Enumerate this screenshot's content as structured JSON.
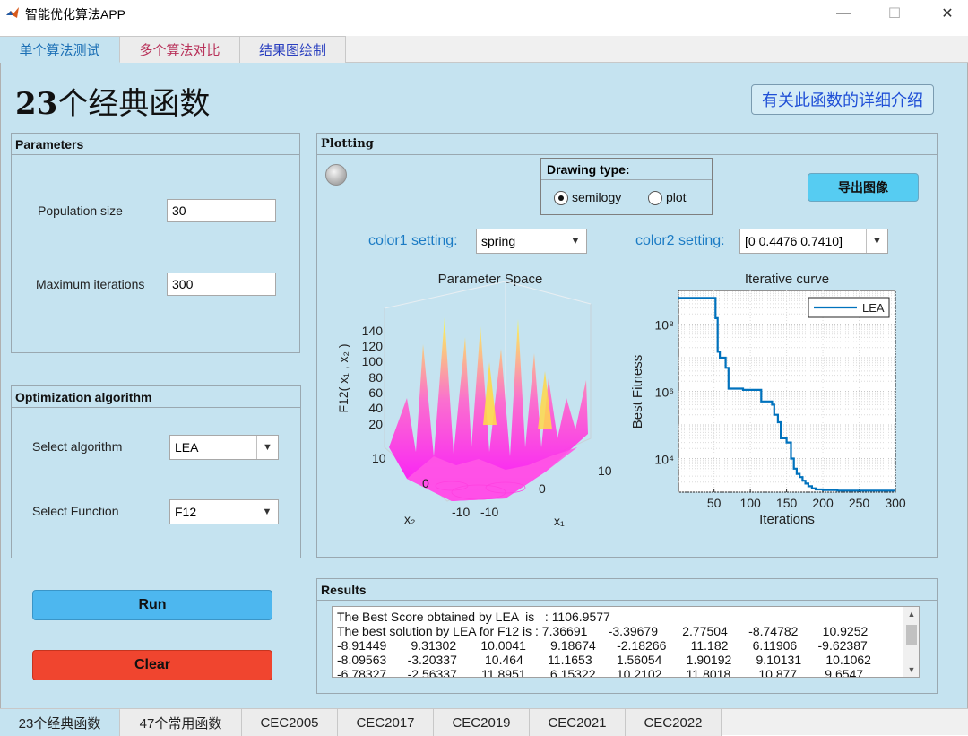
{
  "window": {
    "title": "智能优化算法APP",
    "minimize": "—",
    "maximize": "☐",
    "close": "✕"
  },
  "top_tabs": [
    "单个算法测试",
    "多个算法对比",
    "结果图绘制"
  ],
  "header": {
    "title_num": "23",
    "title_text": "个经典函数",
    "detail_button": "有关此函数的详细介绍"
  },
  "parameters": {
    "title": "Parameters",
    "population_label": "Population size",
    "population_value": "30",
    "iterations_label": "Maximum iterations",
    "iterations_value": "300"
  },
  "optimization": {
    "title": "Optimization algorithm",
    "algorithm_label": "Select algorithm",
    "algorithm_value": "LEA",
    "function_label": "Select Function",
    "function_value": "F12"
  },
  "buttons": {
    "run": "Run",
    "clear": "Clear",
    "export": "导出图像"
  },
  "plotting": {
    "title": "Plotting",
    "drawing_type_label": "Drawing type:",
    "option_semilogy": "semilogy",
    "option_plot": "plot",
    "selected": "semilogy",
    "color1_label": "color1 setting:",
    "color1_value": "spring",
    "color2_label": "color2 setting:",
    "color2_value": "[0 0.4476 0.7410]"
  },
  "parameter_space_plot": {
    "title": "Parameter Space",
    "zlabel": "F12(  x₁  ,  x₂  )",
    "z_ticks": [
      "140",
      "120",
      "100",
      "80",
      "60",
      "40",
      "20"
    ],
    "x2_ticks": [
      "10",
      "0",
      "-10"
    ],
    "x1_ticks": [
      "-10",
      "0",
      "10"
    ],
    "x2_label": "x₂",
    "x1_label": "x₁"
  },
  "chart_data": {
    "type": "line",
    "title": "Iterative curve",
    "xlabel": "Iterations",
    "ylabel": "Best Fitness",
    "yscale": "log",
    "xlim": [
      1,
      300
    ],
    "ylim": [
      1000,
      1000000000
    ],
    "x_ticks": [
      "50",
      "100",
      "150",
      "200",
      "250",
      "300"
    ],
    "y_ticks": [
      "10⁴",
      "10⁶",
      "10⁸"
    ],
    "legend_position": "top-right",
    "color": "#0072bd",
    "series": [
      {
        "name": "LEA",
        "x": [
          1,
          10,
          20,
          30,
          40,
          48,
          52,
          55,
          58,
          62,
          66,
          70,
          75,
          80,
          90,
          100,
          110,
          115,
          120,
          125,
          130,
          133,
          138,
          142,
          146,
          150,
          156,
          160,
          164,
          168,
          172,
          176,
          180,
          185,
          190,
          200,
          220,
          250,
          300
        ],
        "y": [
          600000000,
          600000000,
          600000000,
          600000000,
          600000000,
          600000000,
          150000000,
          15000000,
          10000000,
          10000000,
          5000000,
          1200000,
          1200000,
          1200000,
          1100000,
          1100000,
          1100000,
          500000,
          500000,
          500000,
          400000,
          200000,
          120000,
          40000,
          40000,
          30000,
          10000,
          5000,
          3500,
          2800,
          2200,
          1800,
          1500,
          1300,
          1200,
          1150,
          1110,
          1107,
          1106.96
        ]
      }
    ]
  },
  "results": {
    "title": "Results",
    "lines": [
      "The Best Score obtained by LEA  is   : 1106.9577",
      "The best solution by LEA for F12 is : 7.36691      -3.39679       2.77504      -8.74782       10.9252",
      "-8.91449       9.31302       10.0041       9.18674      -2.18266       11.182       6.11906      -9.62387",
      "-8.09563      -3.20337        10.464       11.1653       1.56054       1.90192       9.10131       10.1062",
      "-6.78327      -2.56337       11.8951       6.15322      10.2102       11.8018        10.877        9.6547"
    ]
  },
  "bottom_tabs": [
    "23个经典函数",
    "47个常用函数",
    "CEC2005",
    "CEC2017",
    "CEC2019",
    "CEC2021",
    "CEC2022"
  ]
}
